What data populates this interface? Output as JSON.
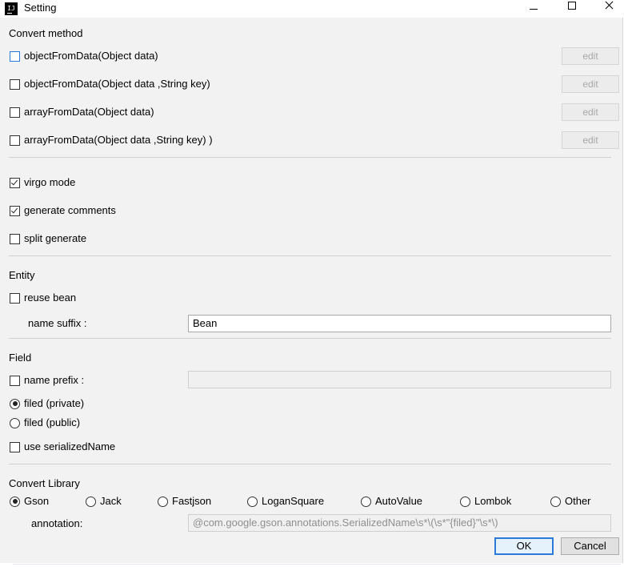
{
  "window": {
    "title": "Setting",
    "app_icon_text": "IJ"
  },
  "convert_method": {
    "title": "Convert method",
    "items": [
      {
        "label": "objectFromData(Object data)",
        "checked": false,
        "edit_label": "edit"
      },
      {
        "label": "objectFromData(Object data ,String key)",
        "checked": false,
        "edit_label": "edit"
      },
      {
        "label": "arrayFromData(Object data)",
        "checked": false,
        "edit_label": "edit"
      },
      {
        "label": "arrayFromData(Object data ,String key) )",
        "checked": false,
        "edit_label": "edit"
      }
    ]
  },
  "options": {
    "items": [
      {
        "label": "virgo mode",
        "checked": true
      },
      {
        "label": "generate comments",
        "checked": true
      },
      {
        "label": "split generate",
        "checked": false
      }
    ]
  },
  "entity": {
    "title": "Entity",
    "reuse_bean": {
      "label": "reuse bean",
      "checked": false
    },
    "name_suffix": {
      "label": "name suffix :",
      "value": "Bean"
    }
  },
  "field": {
    "title": "Field",
    "name_prefix": {
      "label": "name prefix :",
      "checked": false,
      "value": ""
    },
    "visibility": [
      {
        "label": "filed (private)",
        "selected": true
      },
      {
        "label": "filed (public)",
        "selected": false
      }
    ],
    "use_serialized_name": {
      "label": "use serializedName",
      "checked": false
    }
  },
  "convert_library": {
    "title": "Convert Library",
    "options": [
      {
        "label": "Gson",
        "selected": true
      },
      {
        "label": "Jack",
        "selected": false
      },
      {
        "label": "Fastjson",
        "selected": false
      },
      {
        "label": "LoganSquare",
        "selected": false
      },
      {
        "label": "AutoValue",
        "selected": false
      },
      {
        "label": "Lombok",
        "selected": false
      },
      {
        "label": "Other",
        "selected": false
      }
    ],
    "annotation": {
      "label": "annotation:",
      "value": "@com.google.gson.annotations.SerializedName\\s*\\(\\s*\"{filed}\"\\s*\\)"
    }
  },
  "buttons": {
    "ok": "OK",
    "cancel": "Cancel"
  }
}
